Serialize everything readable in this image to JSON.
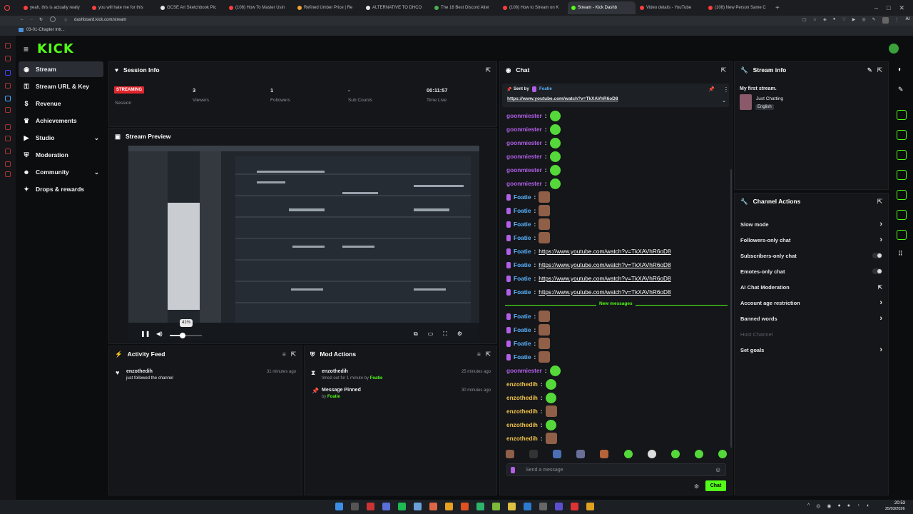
{
  "browser": {
    "tabs": [
      {
        "label": "yeah, this is actually really",
        "color": "#ff3d3d"
      },
      {
        "label": "you will hate me for this",
        "color": "#ff3d3d"
      },
      {
        "label": "GCSE Art Sketchbook Pic",
        "color": "#e6e6e6"
      },
      {
        "label": "(108) How To Master Usin",
        "color": "#ff3d3d"
      },
      {
        "label": "Refined Umber Price | Re",
        "color": "#f0a030"
      },
      {
        "label": "ALTERNATIVE TO DHCO",
        "color": "#e6e6e6"
      },
      {
        "label": "The 18 Best Discord Alter",
        "color": "#4caf50"
      },
      {
        "label": "(108) How to Stream on K",
        "color": "#ff3d3d"
      },
      {
        "label": "Stream - Kick Dashb",
        "color": "#53fc18",
        "active": true
      },
      {
        "label": "Video details - YouTube",
        "color": "#ff3d3d"
      },
      {
        "label": "(108) New Person Same C",
        "color": "#ff3d3d"
      }
    ],
    "url": "dashboard.kick.com/stream",
    "bookmark": "03-01-Chapter Intr...",
    "ai_label": "AI"
  },
  "app": {
    "logo": "KICK"
  },
  "sidebar": {
    "items": [
      {
        "label": "Stream",
        "icon": "stream-icon",
        "active": true
      },
      {
        "label": "Stream URL & Key",
        "icon": "key-icon"
      },
      {
        "label": "Revenue",
        "icon": "revenue-icon"
      },
      {
        "label": "Achievements",
        "icon": "trophy-icon"
      },
      {
        "label": "Studio",
        "icon": "studio-icon",
        "expandable": true
      },
      {
        "label": "Moderation",
        "icon": "shield-icon"
      },
      {
        "label": "Community",
        "icon": "community-icon",
        "expandable": true
      },
      {
        "label": "Drops & rewards",
        "icon": "gift-icon"
      }
    ]
  },
  "session": {
    "title": "Session Info",
    "badge": "STREAMING",
    "stats": [
      {
        "value": "",
        "label": "Session"
      },
      {
        "value": "3",
        "label": "Viewers"
      },
      {
        "value": "1",
        "label": "Followers"
      },
      {
        "value": "-",
        "label": "Sub Counts"
      },
      {
        "value": "00:11:57",
        "label": "Time Live"
      }
    ]
  },
  "preview": {
    "title": "Stream Preview",
    "volume_tooltip": "41%",
    "volume_level": 0.41
  },
  "activity": {
    "title": "Activity Feed",
    "items": [
      {
        "user": "enzothedih",
        "text": "just followed the channel",
        "time": "31 minutes ago"
      }
    ]
  },
  "mod": {
    "title": "Mod Actions",
    "items": [
      {
        "title": "enzothedih",
        "text": "timed out for 1 minute by",
        "by": "Foatie",
        "time": "25 minutes ago"
      },
      {
        "title": "Message Pinned",
        "text": "by",
        "by": "Foatie",
        "time": "30 minutes ago"
      }
    ]
  },
  "chat": {
    "title": "Chat",
    "pinned_by_label": "Sent by",
    "pinned_by": "Foatie",
    "pinned_link": "https://www.youtube.com/watch?v=TkXAVhR6oD8",
    "new_messages": "New messages",
    "input_placeholder": "Send a message",
    "send_label": "Chat",
    "lines": [
      {
        "user": "goonmiester",
        "color": "purple",
        "content": "emote"
      },
      {
        "user": "goonmiester",
        "color": "purple",
        "content": "emote"
      },
      {
        "user": "goonmiester",
        "color": "purple",
        "content": "emote"
      },
      {
        "user": "goonmiester",
        "color": "purple",
        "content": "emote"
      },
      {
        "user": "goonmiester",
        "color": "purple",
        "content": "emote"
      },
      {
        "user": "goonmiester",
        "color": "purple",
        "content": "emote"
      },
      {
        "user": "Foatie",
        "color": "blue",
        "content": "face"
      },
      {
        "user": "Foatie",
        "color": "blue",
        "content": "face"
      },
      {
        "user": "Foatie",
        "color": "blue",
        "content": "face"
      },
      {
        "user": "Foatie",
        "color": "blue",
        "content": "face"
      },
      {
        "user": "Foatie",
        "color": "blue",
        "link": "https://www.youtube.com/watch?v=TkXAVhR6oD8"
      },
      {
        "user": "Foatie",
        "color": "blue",
        "link": "https://www.youtube.com/watch?v=TkXAVhR6oD8"
      },
      {
        "user": "Foatie",
        "color": "blue",
        "link": "https://www.youtube.com/watch?v=TkXAVhR6oD8"
      },
      {
        "user": "Foatie",
        "color": "blue",
        "link": "https://www.youtube.com/watch?v=TkXAVhR6oD8"
      }
    ],
    "lines_after": [
      {
        "user": "Foatie",
        "color": "blue",
        "content": "face"
      },
      {
        "user": "Foatie",
        "color": "blue",
        "content": "face"
      },
      {
        "user": "Foatie",
        "color": "blue",
        "content": "face"
      },
      {
        "user": "Foatie",
        "color": "blue",
        "content": "face"
      },
      {
        "user": "goonmiester",
        "color": "purple",
        "content": "emote"
      },
      {
        "user": "enzothedih",
        "color": "yellow",
        "content": "emote"
      },
      {
        "user": "enzothedih",
        "color": "yellow",
        "content": "emote"
      },
      {
        "user": "enzothedih",
        "color": "yellow",
        "content": "face"
      },
      {
        "user": "enzothedih",
        "color": "yellow",
        "content": "emote"
      },
      {
        "user": "enzothedih",
        "color": "yellow",
        "content": "face"
      }
    ]
  },
  "streaminfo": {
    "title": "Stream info",
    "stream_title": "My first stream.",
    "category": "Just Chatting",
    "language": "English"
  },
  "actions": {
    "title": "Channel Actions",
    "items": [
      {
        "label": "Slow mode",
        "control": "chevron"
      },
      {
        "label": "Followers-only chat",
        "control": "chevron"
      },
      {
        "label": "Subscribers-only chat",
        "control": "toggle"
      },
      {
        "label": "Emotes-only chat",
        "control": "toggle"
      },
      {
        "label": "AI Chat Moderation",
        "control": "external"
      },
      {
        "label": "Account age restriction",
        "control": "chevron"
      },
      {
        "label": "Banned words",
        "control": "chevron"
      },
      {
        "label": "Host Channel",
        "control": "none",
        "muted": true
      },
      {
        "label": "Set goals",
        "control": "chevron"
      }
    ]
  },
  "taskbar": {
    "time": "20:53",
    "date": "25/03/2026"
  },
  "colors": {
    "accent": "#53fc18",
    "badge": "#e1262d"
  }
}
